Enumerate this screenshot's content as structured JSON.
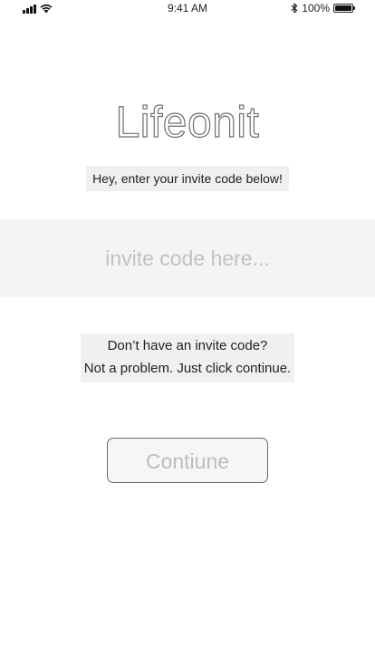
{
  "status_bar": {
    "time": "9:41 AM",
    "battery_text": "100%",
    "battery_level": 1.0,
    "icons": [
      "cellular-signal-icon",
      "wifi-icon",
      "bluetooth-icon",
      "battery-icon"
    ]
  },
  "app": {
    "logo_text": "Lifeonit"
  },
  "invite": {
    "instruction": "Hey, enter your invite code below!",
    "input_value": "",
    "input_placeholder": "invite code here..."
  },
  "help": {
    "line1": "Don’t have an invite code?",
    "line2": "Not a problem. Just click continue."
  },
  "actions": {
    "continue_label": "Contiune"
  },
  "colors": {
    "input_band": "#f4f4f4",
    "label_highlight": "#f0f0f0",
    "button_border": "#6a6a6a",
    "placeholder_text": "#c2c2c2"
  }
}
